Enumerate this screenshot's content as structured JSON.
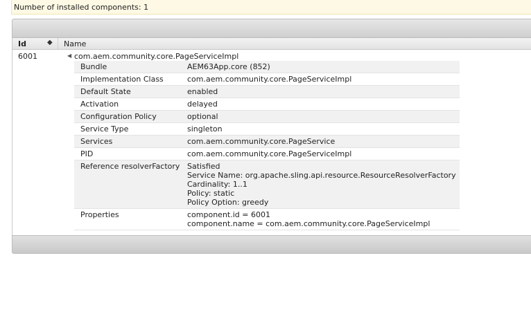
{
  "status": {
    "text": "Number of installed components: 1"
  },
  "table": {
    "headers": {
      "id": "Id",
      "name": "Name"
    },
    "row": {
      "id": "6001",
      "name": "com.aem.community.core.PageServiceImpl",
      "details": [
        {
          "key": "Bundle",
          "values": [
            "AEM63App.core (852)"
          ]
        },
        {
          "key": "Implementation Class",
          "values": [
            "com.aem.community.core.PageServiceImpl"
          ]
        },
        {
          "key": "Default State",
          "values": [
            "enabled"
          ]
        },
        {
          "key": "Activation",
          "values": [
            "delayed"
          ]
        },
        {
          "key": "Configuration Policy",
          "values": [
            "optional"
          ]
        },
        {
          "key": "Service Type",
          "values": [
            "singleton"
          ]
        },
        {
          "key": "Services",
          "values": [
            "com.aem.community.core.PageService"
          ]
        },
        {
          "key": "PID",
          "values": [
            "com.aem.community.core.PageServiceImpl"
          ]
        },
        {
          "key": "Reference resolverFactory",
          "values": [
            "Satisfied",
            "Service Name: org.apache.sling.api.resource.ResourceResolverFactory",
            "Cardinality: 1..1",
            "Policy: static",
            "Policy Option: greedy"
          ]
        },
        {
          "key": "Properties",
          "values": [
            "component.id = 6001",
            "component.name = com.aem.community.core.PageServiceImpl"
          ]
        }
      ]
    }
  },
  "icons": {
    "sort": "sort-icon",
    "expand": "expand-arrow-icon"
  }
}
